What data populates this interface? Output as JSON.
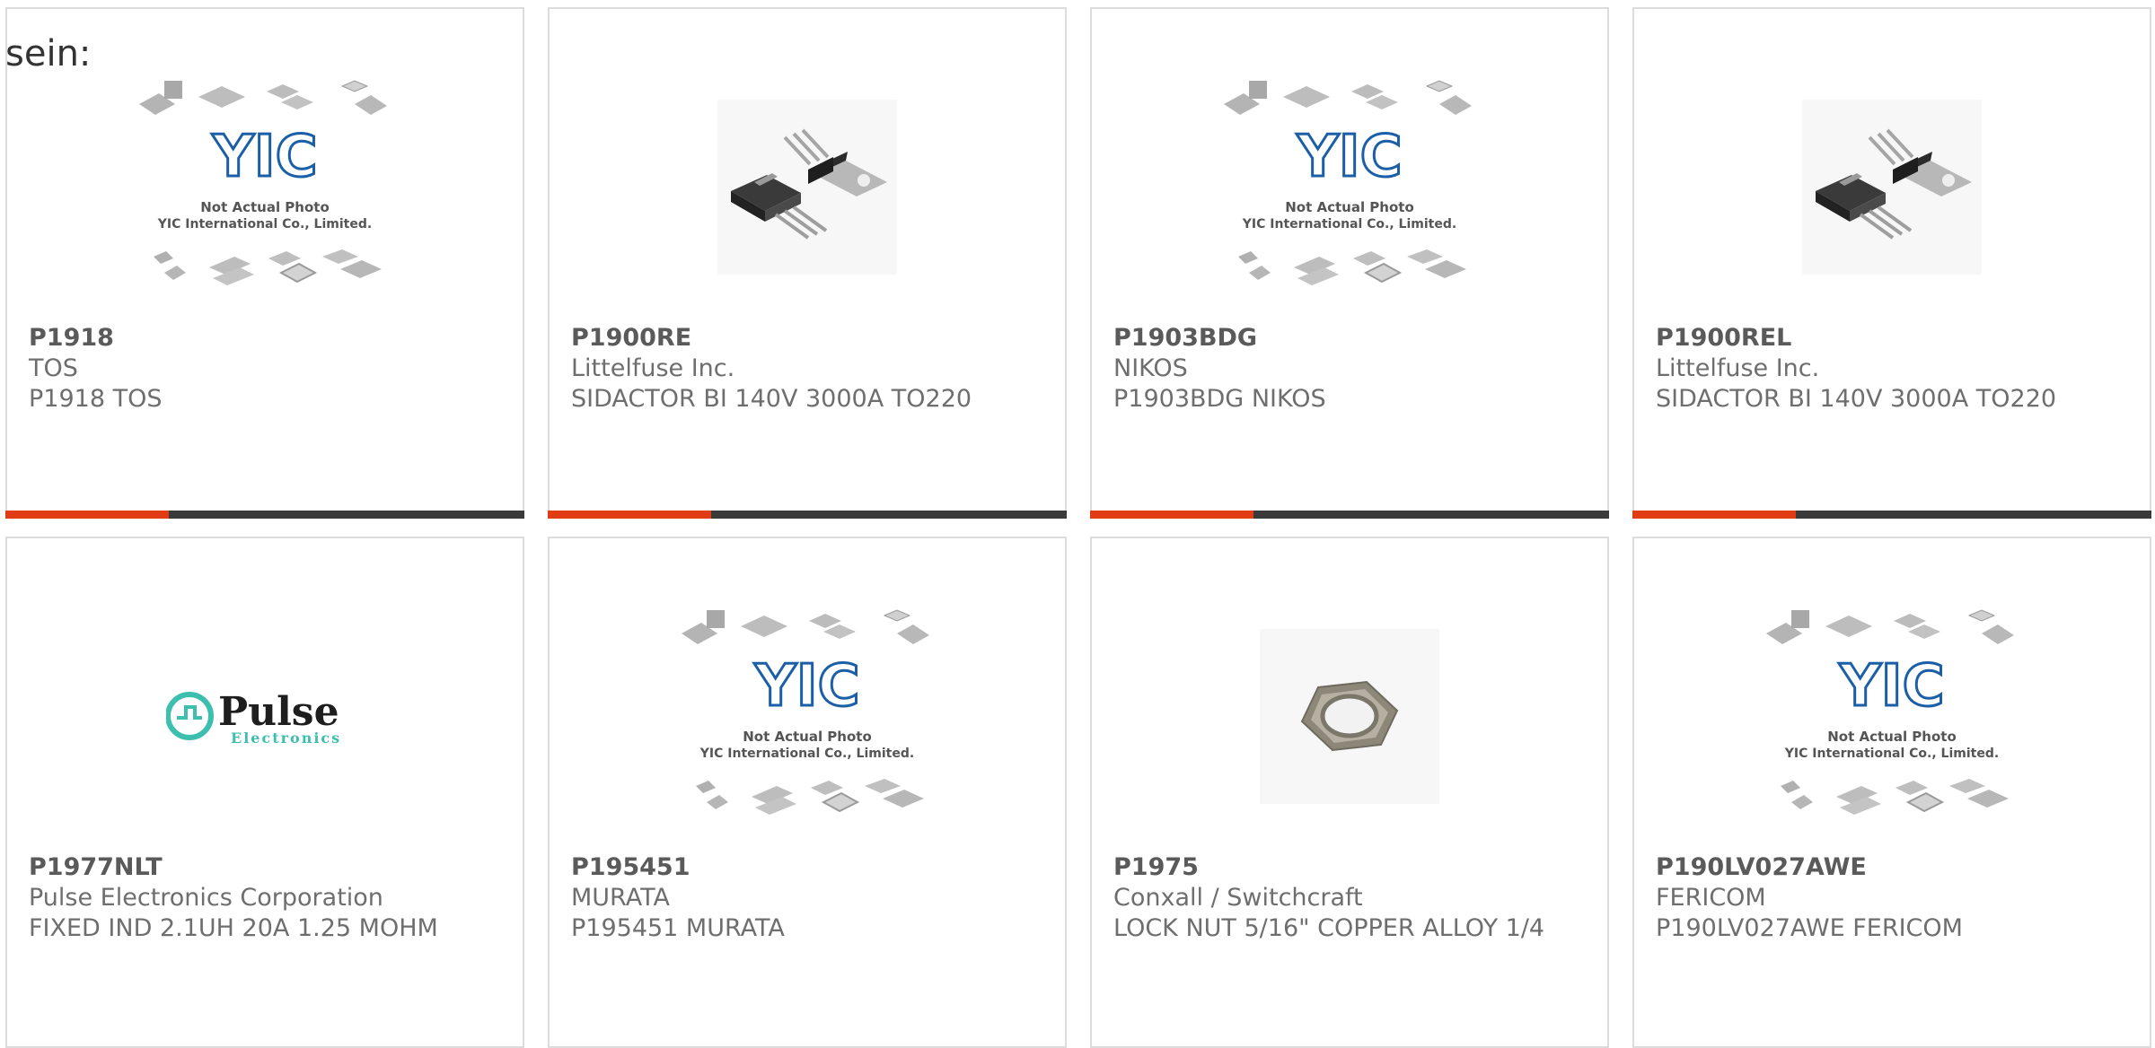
{
  "fragment_text": "sein:",
  "placeholder_text": {
    "line1": "Not Actual Photo",
    "line2": "YIC International Co., Limited.",
    "logo": "YIC"
  },
  "pulse_logo": {
    "word": "Pulse",
    "sub": "Electronics"
  },
  "colors": {
    "accent": "#e13c14",
    "bar": "#3a3a3a",
    "logo_blue": "#1a5fa8",
    "pulse_teal": "#3cbfae"
  },
  "products": [
    {
      "part": "P1918",
      "manufacturer": "TOS",
      "description": "P1918 TOS",
      "image": "placeholder-icon"
    },
    {
      "part": "P1900RE",
      "manufacturer": "Littelfuse Inc.",
      "description": "SIDACTOR BI 140V 3000A TO220",
      "image": "to220-photo-icon"
    },
    {
      "part": "P1903BDG",
      "manufacturer": "NIKOS",
      "description": "P1903BDG NIKOS",
      "image": "placeholder-icon"
    },
    {
      "part": "P1900REL",
      "manufacturer": "Littelfuse Inc.",
      "description": "SIDACTOR BI 140V 3000A TO220",
      "image": "to220-photo-icon"
    },
    {
      "part": "P1977NLT",
      "manufacturer": "Pulse Electronics Corporation",
      "description": "FIXED IND 2.1UH 20A 1.25 MOHM",
      "image": "pulse-logo-icon"
    },
    {
      "part": "P195451",
      "manufacturer": "MURATA",
      "description": "P195451 MURATA",
      "image": "placeholder-icon"
    },
    {
      "part": "P1975",
      "manufacturer": "Conxall / Switchcraft",
      "description": "LOCK NUT 5/16\" COPPER ALLOY 1/4",
      "image": "lock-nut-photo-icon"
    },
    {
      "part": "P190LV027AWE",
      "manufacturer": "FERICOM",
      "description": "P190LV027AWE FERICOM",
      "image": "placeholder-icon"
    }
  ]
}
